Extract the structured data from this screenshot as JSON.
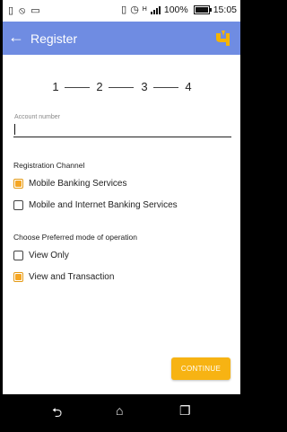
{
  "status_bar": {
    "battery_percent": "100%",
    "time": "15:05",
    "battery_level": 1.0,
    "icons": [
      "sim-icon",
      "alarm-off-icon",
      "message-icon",
      "vibrate-icon",
      "alarm-icon",
      "data-icon",
      "signal-icon",
      "battery-icon"
    ]
  },
  "app_bar": {
    "title": "Register",
    "back_icon": "arrow-left-icon",
    "logo_icon": "bank-logo-icon",
    "background": "#6f8ce2"
  },
  "stepper": {
    "steps": [
      "1",
      "2",
      "3",
      "4"
    ]
  },
  "account": {
    "label": "Account number",
    "value": ""
  },
  "registration": {
    "heading": "Registration Channel",
    "options": [
      {
        "label": "Mobile Banking Services",
        "checked": true
      },
      {
        "label": "Mobile and Internet Banking Services",
        "checked": false
      }
    ]
  },
  "mode": {
    "heading": "Choose Preferred mode of operation",
    "options": [
      {
        "label": "View Only",
        "checked": false
      },
      {
        "label": "View and Transaction",
        "checked": true
      }
    ]
  },
  "continue_label": "CONTINUE",
  "colors": {
    "accent": "#f7b313",
    "checkbox_fill": "#f5a623"
  },
  "nav_bar": {
    "icons": [
      "back-nav-icon",
      "home-nav-icon",
      "recents-nav-icon"
    ]
  }
}
